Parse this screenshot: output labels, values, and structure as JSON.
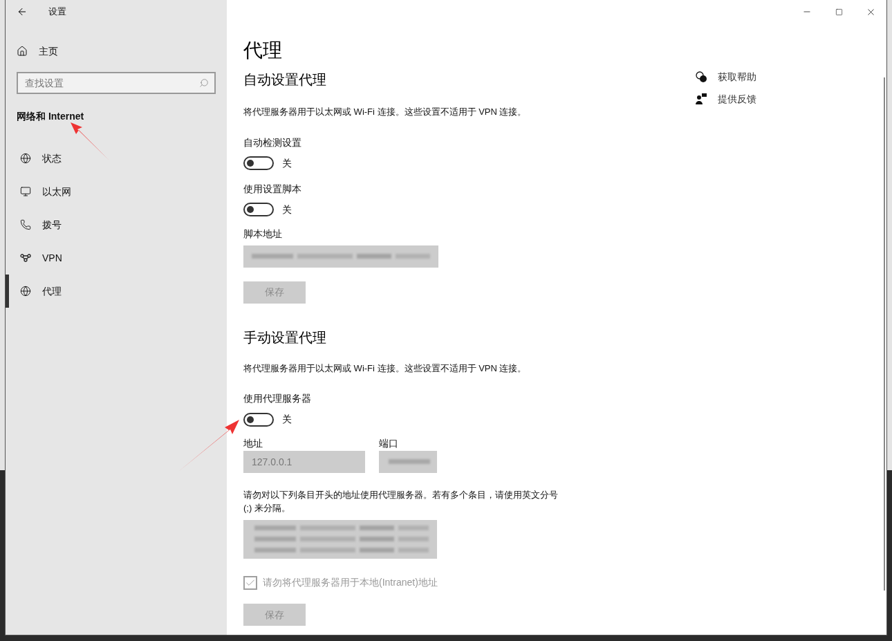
{
  "window": {
    "title": "设置"
  },
  "sidebar": {
    "home": "主页",
    "search": {
      "placeholder": "查找设置"
    },
    "group": "网络和 Internet",
    "items": [
      {
        "label": "状态",
        "selected": false
      },
      {
        "label": "以太网",
        "selected": false
      },
      {
        "label": "拨号",
        "selected": false
      },
      {
        "label": "VPN",
        "selected": false
      },
      {
        "label": "代理",
        "selected": true
      }
    ]
  },
  "page_title": "代理",
  "auto": {
    "heading": "自动设置代理",
    "note": "将代理服务器用于以太网或 Wi-Fi 连接。这些设置不适用于 VPN 连接。",
    "toggles": [
      {
        "label": "自动检测设置",
        "on": false,
        "state": "关"
      },
      {
        "label": "使用设置脚本",
        "on": false,
        "state": "关"
      }
    ],
    "script_label": "脚本地址",
    "save": {
      "label": "保存",
      "disabled": true
    }
  },
  "manual": {
    "heading": "手动设置代理",
    "note": "将代理服务器用于以太网或 Wi-Fi 连接。这些设置不适用于 VPN 连接。",
    "toggle": {
      "label": "使用代理服务器",
      "on": false,
      "state": "关"
    },
    "address": {
      "label": "地址",
      "value": "127.0.0.1"
    },
    "port": {
      "label": "端口"
    },
    "exceptions_note": "请勿对以下列条目开头的地址使用代理服务器。若有多个条目，请使用英文分号 (;) 来分隔。",
    "local": {
      "label": "请勿将代理服务器用于本地(Intranet)地址",
      "checked": true,
      "disabled": true
    },
    "save": {
      "label": "保存",
      "disabled": true
    }
  },
  "help": [
    {
      "label": "获取帮助"
    },
    {
      "label": "提供反馈"
    }
  ]
}
